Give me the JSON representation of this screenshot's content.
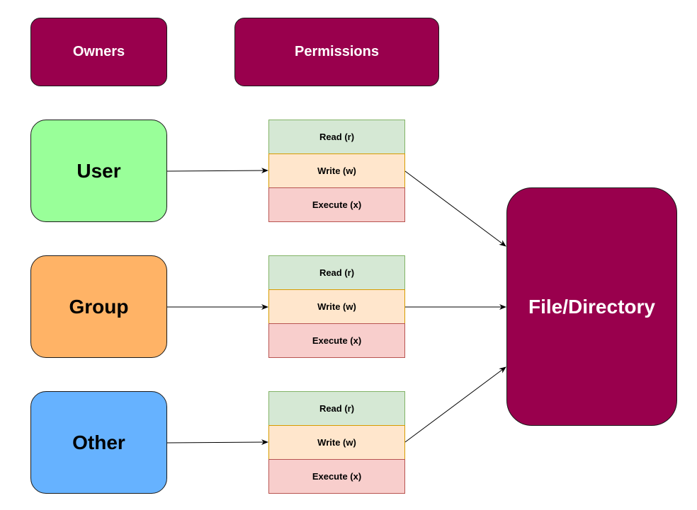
{
  "headers": {
    "owners": "Owners",
    "permissions": "Permissions"
  },
  "owners": [
    {
      "label": "User",
      "color": "#99ff99"
    },
    {
      "label": "Group",
      "color": "#ffb366"
    },
    {
      "label": "Other",
      "color": "#66b2ff"
    }
  ],
  "permission_sets": [
    {
      "read": "Read (r)",
      "write": "Write (w)",
      "execute": "Execute (x)"
    },
    {
      "read": "Read (r)",
      "write": "Write (w)",
      "execute": "Execute (x)"
    },
    {
      "read": "Read (r)",
      "write": "Write (w)",
      "execute": "Execute (x)"
    }
  ],
  "target": {
    "label": "File/Directory",
    "color": "#99004d"
  }
}
